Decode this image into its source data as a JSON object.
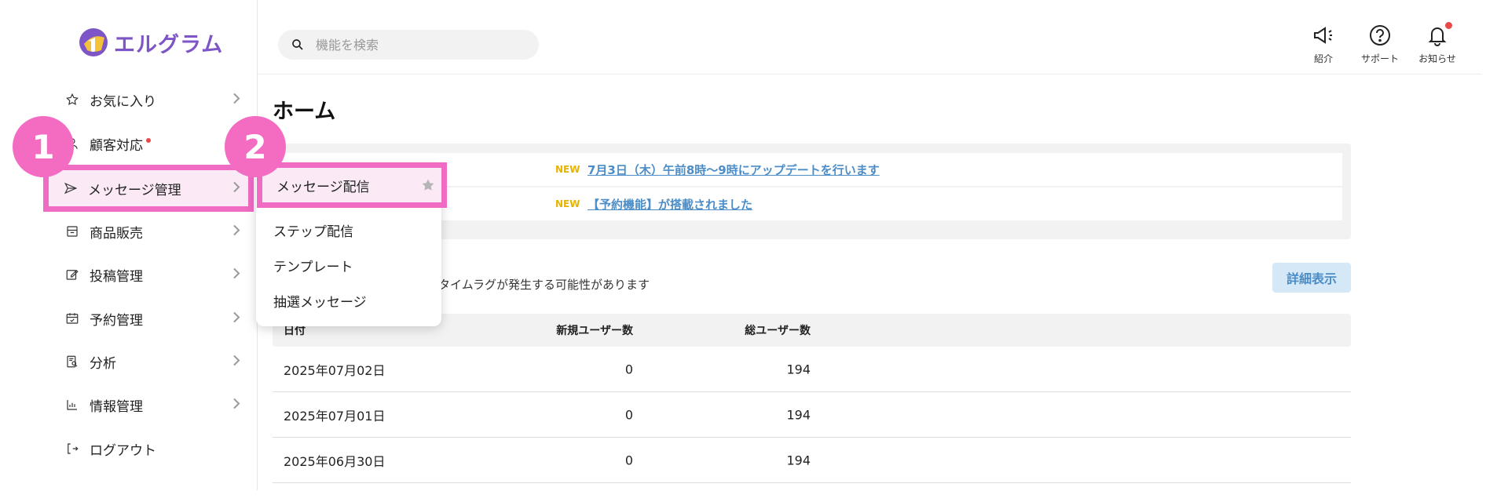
{
  "app": {
    "name": "エルグラム"
  },
  "sidebar": {
    "items": [
      {
        "label": "お気に入り",
        "icon": "star-outline-icon"
      },
      {
        "label": "顧客対応",
        "icon": "user-icon"
      },
      {
        "label": "メッセージ管理",
        "icon": "send-icon"
      },
      {
        "label": "商品販売",
        "icon": "store-icon"
      },
      {
        "label": "投稿管理",
        "icon": "edit-icon"
      },
      {
        "label": "予約管理",
        "icon": "calendar-icon"
      },
      {
        "label": "分析",
        "icon": "report-search-icon"
      },
      {
        "label": "情報管理",
        "icon": "bar-chart-icon"
      },
      {
        "label": "ログアウト",
        "icon": "logout-icon"
      }
    ]
  },
  "search": {
    "placeholder": "機能を検索"
  },
  "topbar": {
    "intro": {
      "label": "紹介",
      "icon": "megaphone-icon"
    },
    "support": {
      "label": "サポート",
      "icon": "help-circle-icon"
    },
    "notifications": {
      "label": "お知らせ",
      "icon": "bell-icon"
    }
  },
  "page": {
    "title": "ホーム"
  },
  "news": {
    "tag": "NEW",
    "items": [
      {
        "tag": "NEW",
        "text": "7月3日（木）午前8時〜9時にアップデートを行います"
      },
      {
        "tag": "NEW",
        "text": "【予約機能】が搭載されました"
      }
    ]
  },
  "stats": {
    "note": "値とタイムラグが発生する可能性があります",
    "detail_label": "詳細表示",
    "headers": [
      "日付",
      "新規ユーザー数",
      "総ユーザー数"
    ],
    "rows": [
      [
        "2025年07月02日",
        "0",
        "194"
      ],
      [
        "2025年07月01日",
        "0",
        "194"
      ],
      [
        "2025年06月30日",
        "0",
        "194"
      ]
    ]
  },
  "submenu": {
    "items": [
      "メッセージ配信",
      "ステップ配信",
      "テンプレート",
      "抽選メッセージ"
    ]
  },
  "badges": {
    "step1": "1",
    "step2": "2"
  },
  "colors": {
    "brand": "#7d55c7",
    "highlight": "#f06bc3",
    "highlight_bg": "#fbeaf6",
    "new_tag": "#e8b300",
    "link": "#4c8dc7",
    "alert": "#e74a4a"
  }
}
